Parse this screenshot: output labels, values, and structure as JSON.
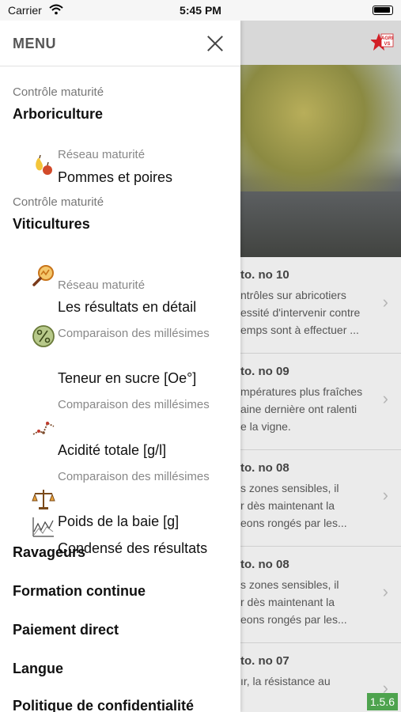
{
  "status_bar": {
    "carrier": "Carrier",
    "time": "5:45 PM"
  },
  "drawer": {
    "title": "MENU",
    "sections": [
      {
        "caption": "Contrôle maturité",
        "title": "Arboriculture"
      },
      {
        "caption": "Contrôle maturité",
        "title": "Viticultures"
      }
    ],
    "arbo_items": [
      {
        "caption": "Réseau maturité",
        "label": "Pommes et poires",
        "icon": "pear-apple-icon"
      }
    ],
    "viti_items": [
      {
        "caption": "Réseau maturité",
        "label": "Les résultats en détail",
        "icon": "magnifier-graph-icon"
      },
      {
        "caption": "Comparaison des millésimes",
        "label": "Teneur en sucre [Oe°]",
        "icon": "percent-icon"
      },
      {
        "caption": "Comparaison des millésimes",
        "label": "Acidité totale [g/l]",
        "icon": "line-graph-icon"
      },
      {
        "caption": "Comparaison des millésimes",
        "label": "Poids de la baie [g]",
        "icon": "scale-icon"
      },
      {
        "caption": "",
        "label": "Condensé des résultats",
        "icon": "chart-summary-icon"
      }
    ],
    "bottom_items": [
      "Ravageurs",
      "Formation continue",
      "Paiement direct",
      "Langue",
      "Politique de confidentialité"
    ]
  },
  "background": {
    "logo": "AGRI VS",
    "news": [
      {
        "title": "to. no 10",
        "lines": [
          "ntrôles sur abricotiers",
          "essité d'intervenir contre",
          "emps sont à effectuer ..."
        ]
      },
      {
        "title": "to. no 09",
        "lines": [
          "mpératures plus fraîches",
          "aine dernière ont ralenti",
          "e la vigne."
        ]
      },
      {
        "title": "to. no 08",
        "lines": [
          "s zones sensibles, il",
          "r dès maintenant la",
          "eons rongés par les..."
        ]
      },
      {
        "title": "to. no 08",
        "lines": [
          "s zones sensibles, il",
          "r dès maintenant la",
          "eons rongés par les..."
        ]
      },
      {
        "title": "to. no 07",
        "lines": [
          "ır, la résistance au"
        ]
      }
    ],
    "version": "1.5.6"
  },
  "colors": {
    "version_green": "#4ea34e",
    "drawer_bg": "#ffffff",
    "caption_gray": "#888888"
  }
}
